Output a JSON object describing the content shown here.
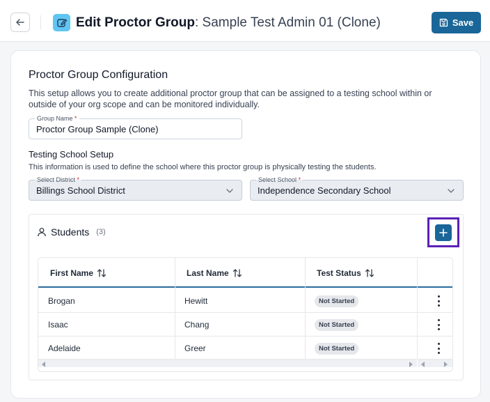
{
  "header": {
    "title_bold": "Edit Proctor Group",
    "title_rest": ": Sample Test Admin 01 (Clone)",
    "save_label": "Save"
  },
  "config": {
    "title": "Proctor Group Configuration",
    "description": "This setup allows you to create additional proctor group that can be assigned to a testing school within or outside of your org scope and can be monitored individually.",
    "group_name_label": "Group Name",
    "group_name_value": "Proctor Group Sample (Clone)"
  },
  "school_setup": {
    "title": "Testing School Setup",
    "description": "This information is used to define the school where this proctor group is physically testing the students.",
    "district_label": "Select District",
    "district_value": "Billings School District",
    "school_label": "Select School",
    "school_value": "Independence Secondary School",
    "required_mark": "*"
  },
  "students": {
    "label": "Students",
    "count": "(3)",
    "columns": [
      "First Name",
      "Last Name",
      "Test Status"
    ],
    "rows": [
      {
        "first": "Brogan",
        "last": "Hewitt",
        "status": "Not Started"
      },
      {
        "first": "Isaac",
        "last": "Chang",
        "status": "Not Started"
      },
      {
        "first": "Adelaide",
        "last": "Greer",
        "status": "Not Started"
      }
    ]
  },
  "icons": {
    "back": "arrow-left-icon",
    "edit": "edit-icon",
    "save": "save-icon",
    "user": "user-icon",
    "add": "plus-icon",
    "sort": "sort-icon",
    "chevron": "chevron-down-icon",
    "kebab": "kebab-menu-icon"
  },
  "colors": {
    "primary": "#1a6698",
    "edit_icon_bg": "#61c5f2",
    "highlight": "#5b21b6"
  }
}
